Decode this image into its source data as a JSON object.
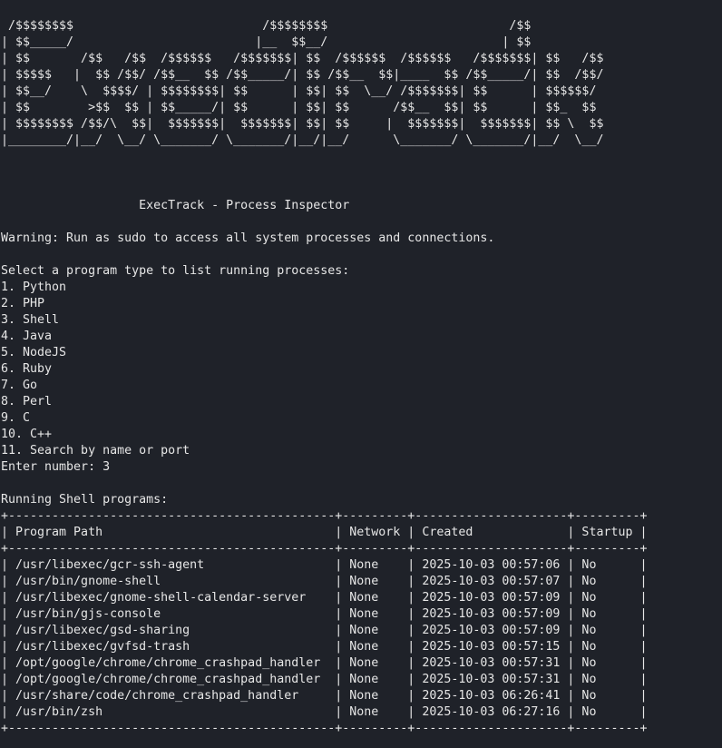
{
  "banner": [
    " /$$$$$$$$                          /$$$$$$$$                         /$$",
    "| $$_____/                         |__  $$__/                        | $$",
    "| $$       /$$   /$$  /$$$$$$   /$$$$$$$| $$  /$$$$$$  /$$$$$$   /$$$$$$$| $$   /$$",
    "| $$$$$   |  $$ /$$/ /$$__  $$ /$$_____/| $$ /$$__  $$|____  $$ /$$_____/| $$  /$$/",
    "| $$__/    \\  $$$$/ | $$$$$$$$| $$      | $$| $$  \\__/ /$$$$$$$| $$      | $$$$$$/",
    "| $$        >$$  $$ | $$_____/| $$      | $$| $$      /$$__  $$| $$      | $$_  $$",
    "| $$$$$$$$ /$$/\\  $$|  $$$$$$$|  $$$$$$$| $$| $$     |  $$$$$$$|  $$$$$$$| $$ \\  $$",
    "|________/|__/  \\__/ \\_______/ \\_______/|__/|__/      \\_______/ \\_______/|__/  \\__/"
  ],
  "app_title": "                   ExecTrack - Process Inspector",
  "warning": "Warning: Run as sudo to access all system processes and connections.",
  "menu": {
    "prompt": "Select a program type to list running processes:",
    "items": [
      "1. Python",
      "2. PHP",
      "3. Shell",
      "4. Java",
      "5. NodeJS",
      "6. Ruby",
      "7. Go",
      "8. Perl",
      "9. C",
      "10. C++",
      "11. Search by name or port"
    ],
    "input_label": "Enter number: ",
    "input_value": "3"
  },
  "results": {
    "heading": "Running Shell programs:",
    "table": {
      "border": "+---------------------------------------------+---------+---------------------+---------+",
      "header_row": "| Program Path                                | Network | Created             | Startup |",
      "rows": [
        "| /usr/libexec/gcr-ssh-agent                  | None    | 2025-10-03 00:57:06 | No      |",
        "| /usr/bin/gnome-shell                        | None    | 2025-10-03 00:57:07 | No      |",
        "| /usr/libexec/gnome-shell-calendar-server    | None    | 2025-10-03 00:57:09 | No      |",
        "| /usr/bin/gjs-console                        | None    | 2025-10-03 00:57:09 | No      |",
        "| /usr/libexec/gsd-sharing                    | None    | 2025-10-03 00:57:09 | No      |",
        "| /usr/libexec/gvfsd-trash                    | None    | 2025-10-03 00:57:15 | No      |",
        "| /opt/google/chrome/chrome_crashpad_handler  | None    | 2025-10-03 00:57:31 | No      |",
        "| /opt/google/chrome/chrome_crashpad_handler  | None    | 2025-10-03 00:57:31 | No      |",
        "| /usr/share/code/chrome_crashpad_handler     | None    | 2025-10-03 06:26:41 | No      |",
        "| /usr/bin/zsh                                | None    | 2025-10-03 06:27:16 | No      |"
      ]
    }
  },
  "colors": {
    "background": "#1f2229",
    "foreground": "#e6e6e6"
  }
}
